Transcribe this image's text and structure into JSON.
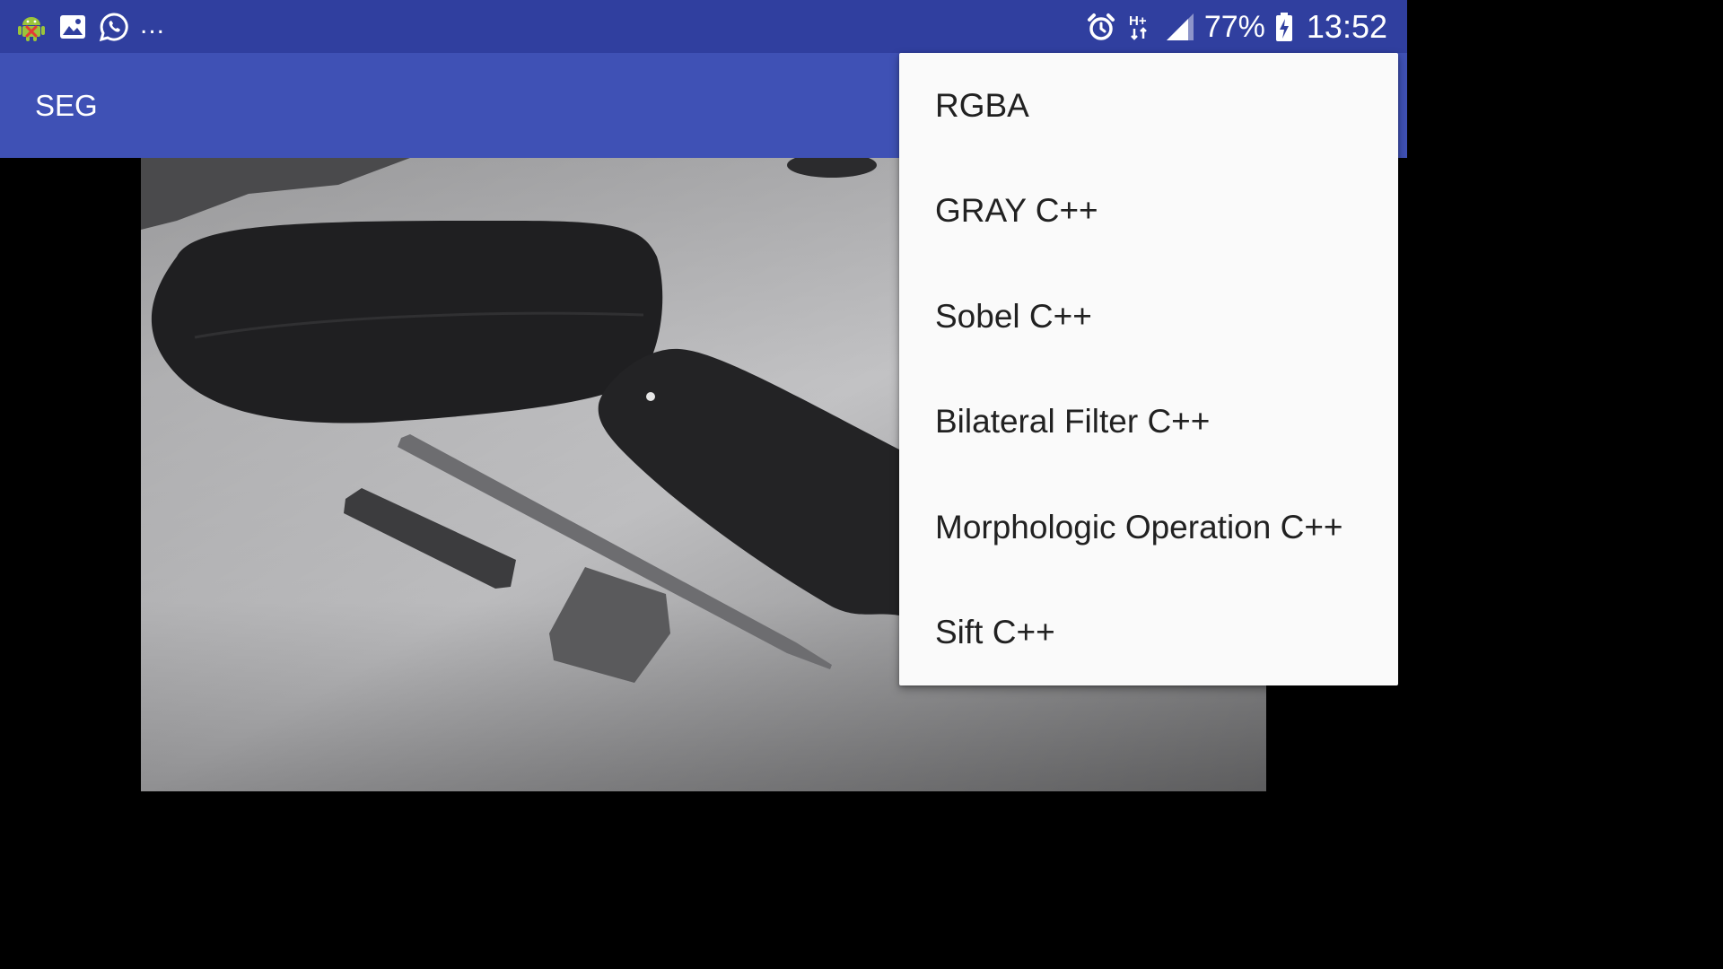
{
  "status_bar": {
    "left_icons": [
      "android-debug-icon",
      "image-icon",
      "whatsapp-icon"
    ],
    "more_indicator": "...",
    "right_icons": [
      "alarm-icon",
      "hplus-data-icon",
      "signal-icon",
      "battery-charging-icon"
    ],
    "battery_percent": "77%",
    "time": "13:52"
  },
  "app_bar": {
    "title": "SEG"
  },
  "menu": {
    "items": [
      {
        "label": "RGBA"
      },
      {
        "label": "GRAY C++"
      },
      {
        "label": "Sobel C++"
      },
      {
        "label": "Bilateral Filter C++"
      },
      {
        "label": "Morphologic Operation C++"
      },
      {
        "label": "Sift C++"
      }
    ]
  },
  "colors": {
    "status_bar": "#303f9f",
    "app_bar": "#3f51b5",
    "menu_background": "#fafafa",
    "menu_text": "#212121"
  }
}
